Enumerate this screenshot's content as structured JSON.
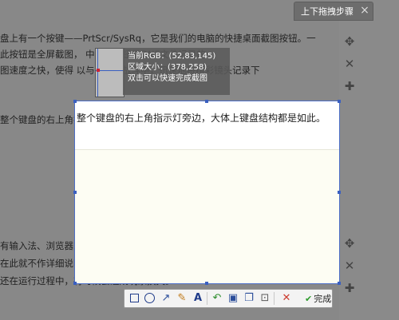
{
  "page": {
    "lines_top": [
      "盘上有一个按键——PrtScr/SysRq，它是我们的电脑的快捷桌面截图按钮。一",
      "此按钮是全屏截图，                                    中，此按钮是DNF文件记录的",
      "图速度之快，使得                                    以与勇士的战斗中，迅速地将精彩镜头记录下"
    ],
    "line_mid": "整个键盘的右上角指示灯旁边，大体上键盘结构都是如此。",
    "lines_bottom": [
      "有输入法、浏览器或者一起其他的截图软件，利用组合键，快速锁定屏幕，达",
      "在此就不作详细说明了。指出两点不足：1.截图速度不如PrtScr键快。2.锁定",
      "还在运行过程中，有时候会造成玩家损失。"
    ]
  },
  "step_panel": {
    "tab_label": "上下拖拽步骤",
    "close_label": "×",
    "icons": [
      "move-icon",
      "close-icon",
      "add-icon",
      "move-icon",
      "close-icon",
      "add-icon"
    ]
  },
  "capture": {
    "info": {
      "rgb": "当前RGB：(52,83,145)",
      "size": "区域大小：(378,258)",
      "hint": "双击可以快速完成截图"
    },
    "toolbar": {
      "finish_label": "完成"
    }
  }
}
